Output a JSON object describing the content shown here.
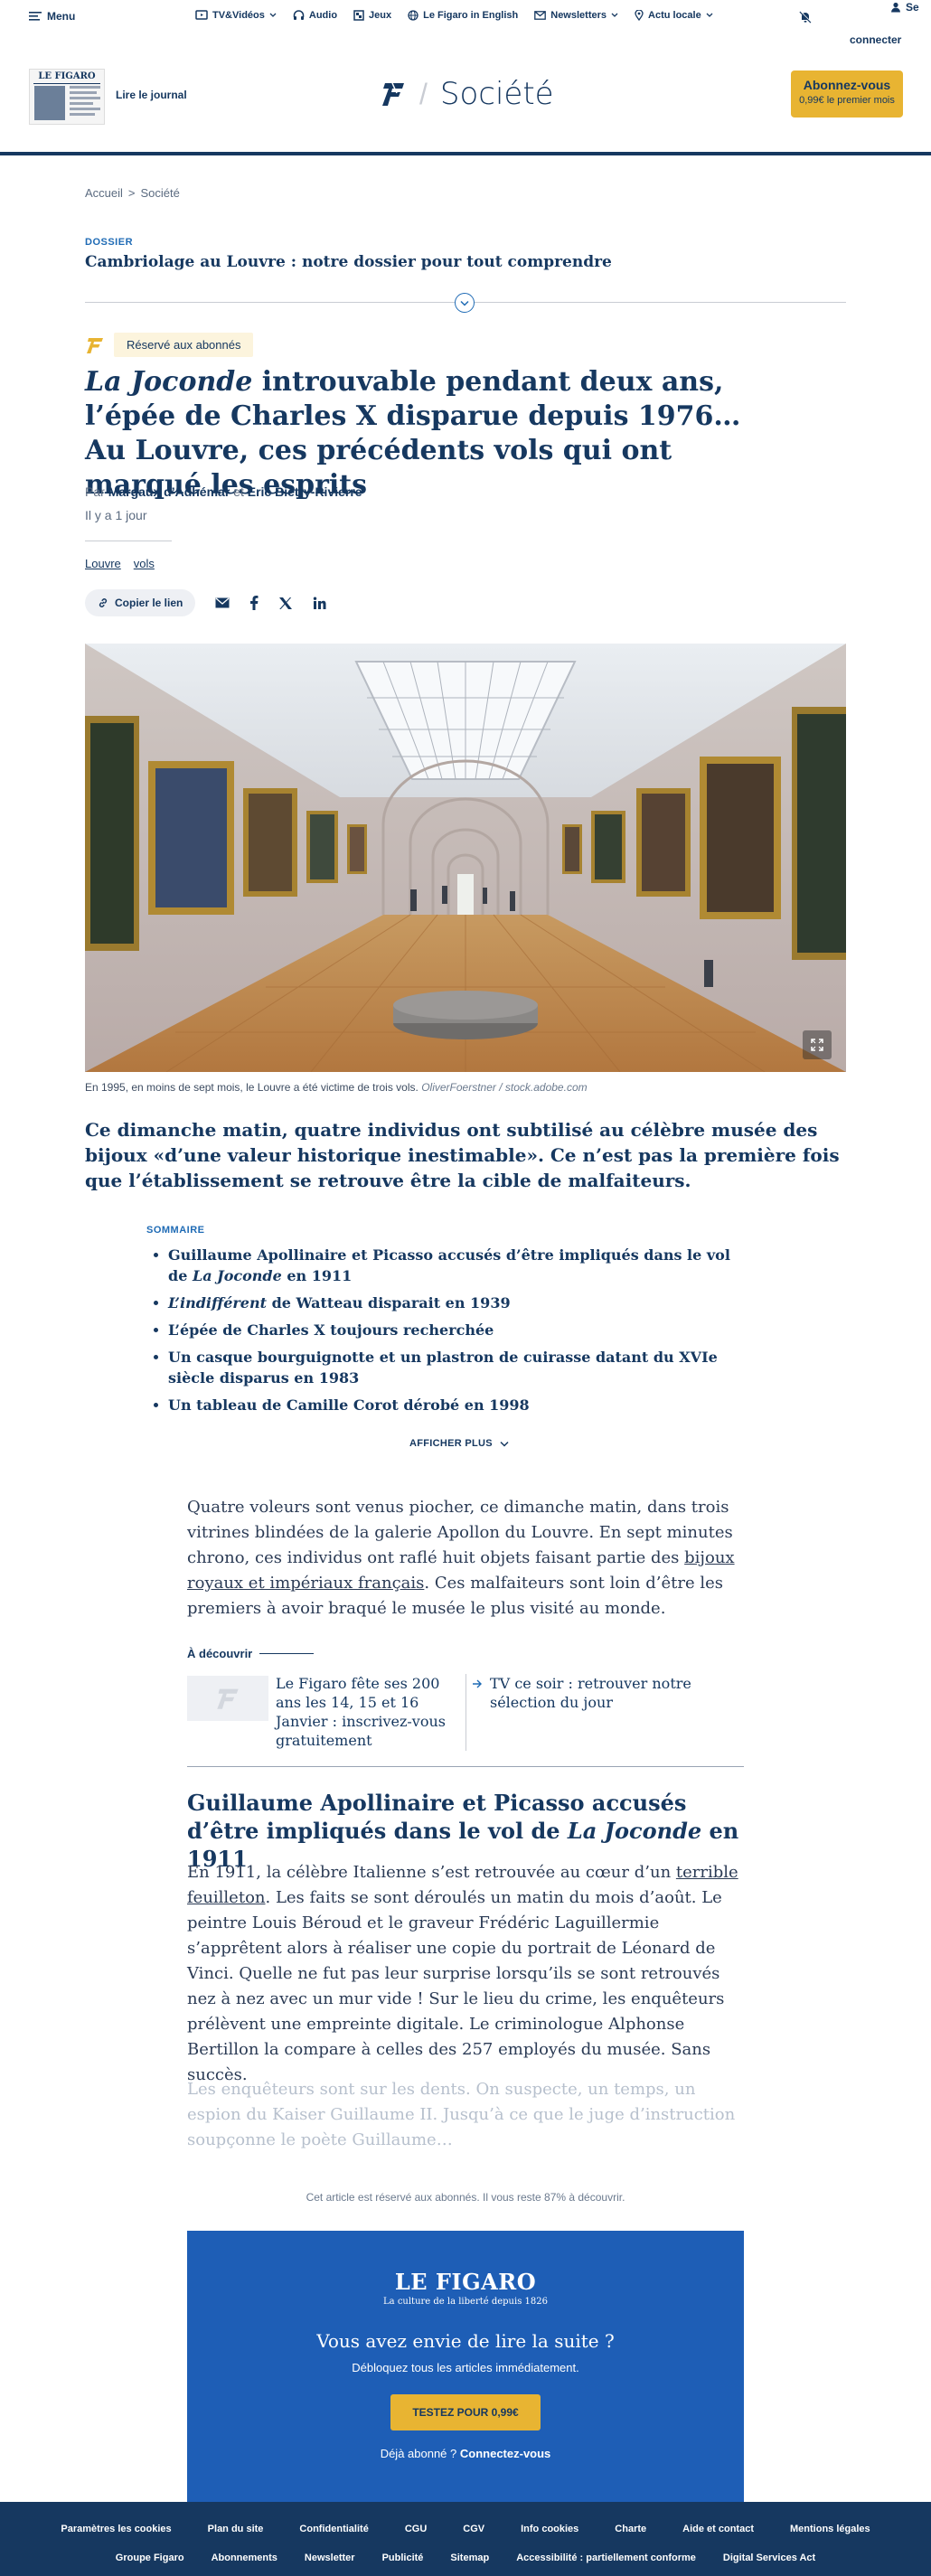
{
  "topbar": {
    "menu_label": "Menu",
    "nav": [
      "TV&Vidéos",
      "Audio",
      "Jeux",
      "Le Figaro in English",
      "Newsletters",
      "Actu locale"
    ],
    "login_line1": "Se",
    "login_line2": "connecter"
  },
  "header": {
    "read_paper": "Lire le journal",
    "thumb_title": "LE FIGARO",
    "section": "Société",
    "subscribe_label": "Abonnez-vous",
    "subscribe_sub": "0,99€ le premier mois"
  },
  "breadcrumb": {
    "home": "Accueil",
    "sep": ">",
    "current": "Société"
  },
  "dossier": {
    "label": "DOSSIER",
    "title": "Cambriolage au Louvre : notre dossier pour tout comprendre"
  },
  "article": {
    "premium_label": "Réservé aux abonnés",
    "headline_italic": "La Joconde",
    "headline_rest": " introuvable pendant deux ans, l’épée de Charles X disparue depuis 1976… Au Louvre, ces précédents vols qui ont marqué les esprits",
    "by": "Par",
    "author1": "Margaux d’Adhémar",
    "and": "et",
    "author2": "Eric Biétry-Rivierre",
    "time": "Il y a 1 jour",
    "tags": [
      "Louvre",
      "vols"
    ],
    "copy_link": "Copier le lien",
    "caption_text": "En 1995, en moins de sept mois, le Louvre a été victime de trois vols.",
    "caption_credit": "OliverFoerstner / stock.adobe.com",
    "lede": "Ce dimanche matin, quatre individus ont subtilisé au célèbre musée des bijoux «d’une valeur historique inestimable». Ce n’est pas la première fois que l’établissement se retrouve être la cible de malfaiteurs."
  },
  "summary": {
    "label": "SOMMAIRE",
    "item1_a": "Guillaume Apollinaire et Picasso accusés d’être impliqués dans le vol de ",
    "item1_i": "La Joconde",
    "item1_b": " en 1911",
    "item2_i": "L’indifférent",
    "item2_b": " de Watteau disparait en 1939",
    "item3": "L’épée de Charles X toujours recherchée",
    "item4": "Un casque bourguignotte et un plastron de cuirasse datant du XVIe siècle disparus en 1983",
    "item5": "Un tableau de Camille Corot dérobé en 1998",
    "more": "AFFICHER PLUS"
  },
  "body": {
    "p1_a": "Quatre voleurs sont venus piocher, ce dimanche matin, dans trois vitrines blindées de la galerie Apollon du Louvre. En sept minutes chrono, ces individus ont raflé huit objets faisant partie des ",
    "p1_link": "bijoux royaux et impériaux français",
    "p1_b": ". Ces malfaiteurs sont loin d’être les premiers à avoir braqué le musée le plus visité au monde.",
    "discover_label": "À découvrir",
    "discover1": "Le Figaro fête ses 200 ans les 14, 15 et 16 Janvier : inscrivez-vous gratuitement",
    "discover2": "TV ce soir : retrouver notre sélection du jour",
    "h2_a": "Guillaume Apollinaire et Picasso accusés d’être impliqués dans le vol de ",
    "h2_i": "La Joconde",
    "h2_b": " en 1911",
    "p2_a": "En 1911, la célèbre Italienne s’est retrouvée au cœur d’un ",
    "p2_link": "terrible feuilleton",
    "p2_b": ". Les faits se sont déroulés un matin du mois d’août. Le peintre Louis Béroud et le graveur Frédéric Laguillermie s’apprêtent alors à réaliser une copie du portrait de Léonard de Vinci. Quelle ne fut pas leur surprise lorsqu’ils se sont retrouvés nez à nez avec un mur vide ! Sur le lieu du crime, les enquêteurs prélèvent une empreinte digitale. Le criminologue Alphonse Bertillon la compare à celles des 257 employés du musée. Sans succès.",
    "p3": "Les enquêteurs sont sur les dents. On suspecte, un temps, un espion du Kaiser Guillaume II. Jusqu’à ce que le juge d’instruction soupçonne le poète Guillaume…"
  },
  "paywall": {
    "note": "Cet article est réservé aux abonnés. Il vous reste 87% à découvrir.",
    "logo": "LE FIGARO",
    "tagline": "La culture de la liberté depuis 1826",
    "title": "Vous avez envie de lire la suite ?",
    "subtitle": "Débloquez tous les articles immédiatement.",
    "button": "TESTEZ POUR 0,99€",
    "already": "Déjà abonné ?",
    "login": "Connectez-vous"
  },
  "footer": {
    "row1": [
      "Paramètres les cookies",
      "Plan du site",
      "Confidentialité",
      "CGU",
      "CGV",
      "Info cookies",
      "Charte",
      "Aide et contact",
      "Mentions légales"
    ],
    "row2": [
      "Groupe Figaro",
      "Abonnements",
      "Newsletter",
      "Publicité",
      "Sitemap",
      "Accessibilité : partiellement conforme",
      "Digital Services Act"
    ]
  },
  "colors": {
    "navy": "#163860",
    "accent_blue": "#1f6bb5",
    "gold": "#e8b432",
    "paywall_blue": "#1e5eb6"
  },
  "icons": [
    "menu-icon",
    "tv-icon",
    "headphones-icon",
    "jeux-icon",
    "globe-icon",
    "mail-icon",
    "pin-icon",
    "chevron-down-icon",
    "bell-off-icon",
    "user-icon",
    "figaro-f-icon",
    "link-icon",
    "email-share-icon",
    "facebook-icon",
    "x-icon",
    "linkedin-icon",
    "expand-icon",
    "arrow-right-icon"
  ]
}
